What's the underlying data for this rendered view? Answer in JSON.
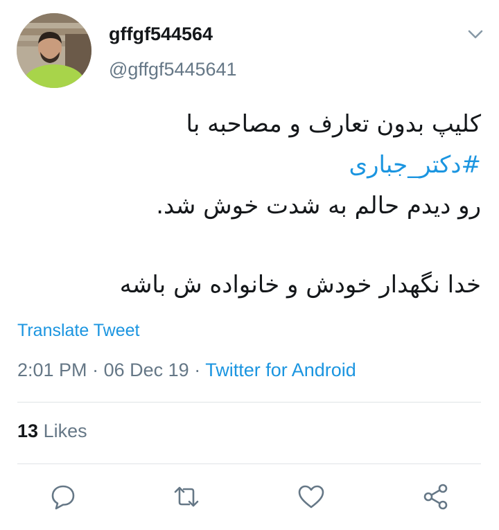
{
  "user": {
    "display_name": "gffgf544564",
    "handle": "@gffgf5445641"
  },
  "tweet": {
    "line1": "کلیپ بدون تعارف و مصاحبه با",
    "hashtag": "#دکتر_جباری",
    "line3": "رو دیدم حالم به شدت خوش شد.",
    "line4": "خدا نگهدار خودش و خانواده ش باشه"
  },
  "translate_label": "Translate Tweet",
  "meta": {
    "time": "2:01 PM",
    "date": "06 Dec 19",
    "separator": "·",
    "source": "Twitter for Android"
  },
  "likes": {
    "count": "13",
    "label": "Likes"
  },
  "icons": {
    "menu": "chevron-down-icon",
    "reply": "reply-icon",
    "retweet": "retweet-icon",
    "like": "heart-icon",
    "share": "share-icon"
  },
  "colors": {
    "link": "#1b95e0",
    "secondary_text": "#657786",
    "primary_text": "#14171a",
    "divider": "#dfe3e6"
  }
}
